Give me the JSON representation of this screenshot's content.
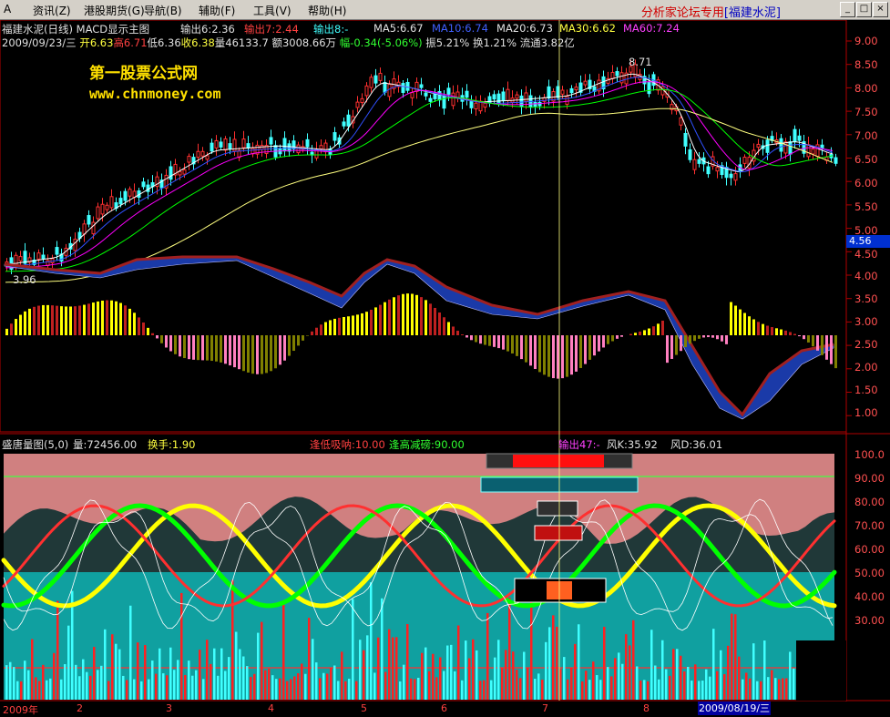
{
  "menu": {
    "items": [
      "资讯",
      "港股期货",
      "导航",
      "辅助",
      "工具",
      "帮助"
    ],
    "item_keys": [
      "(Z)",
      "(G)",
      "(B)",
      "(F)",
      "(V)",
      "(H)"
    ],
    "title_prefix": "分析家论坛专用",
    "title_stock": "[福建水泥]"
  },
  "header": {
    "stock_period": "福建水泥(日线)",
    "indicator_name": "MACD显示主图",
    "out1": "输出6:2.36",
    "out2": "输出7:2.44",
    "out3": "输出8:-",
    "ma5": "MA5:6.67",
    "ma10": "MA10:6.74",
    "ma20": "MA20:6.73",
    "ma30": "MA30:6.62",
    "ma60": "MA60:7.24",
    "date": "2009/09/23/三",
    "open": "开6.63",
    "high": "高6.71",
    "low": "低6.36",
    "close": "收6.38",
    "volume": "量46133.7",
    "amount": "额3008.66万",
    "change": "幅-0.34(-5.06%)",
    "amplitude": "振5.21%",
    "turnover": "换1.21%",
    "float_cap": "流通3.82亿"
  },
  "watermark": {
    "line1": "第一股票公式网",
    "line2": "www.chnmoney.com"
  },
  "annotations": {
    "high_mark": "8.71",
    "low_mark": "3.96"
  },
  "price_axis": [
    "9.00",
    "8.50",
    "8.00",
    "7.50",
    "7.00",
    "6.50",
    "6.00",
    "5.50",
    "5.00",
    "4.50",
    "4.00",
    "3.50",
    "3.00",
    "2.50",
    "2.00",
    "1.50",
    "1.00"
  ],
  "current_price_tag": "4.56",
  "lower_panel": {
    "name": "盛唐量图(5,0)",
    "volume": "量:72456.00",
    "turnover": "换手:1.90",
    "low_absorb": "逢低吸呐:10.00",
    "high_reduce": "逢高减磅:90.00",
    "out47": "输出47:-",
    "wind_k": "风K:35.92",
    "wind_d": "风D:36.01"
  },
  "lower_axis": [
    "100.0",
    "90.00",
    "80.00",
    "70.00",
    "60.00",
    "50.00",
    "40.00",
    "30.00"
  ],
  "date_axis": [
    "2009年",
    "2",
    "3",
    "4",
    "5",
    "6",
    "7",
    "8"
  ],
  "cursor_date": "2009/08/19/三",
  "colors": {
    "up": "#ff3030",
    "down": "#40ffff",
    "ma5": "#ffffff",
    "ma10": "#ffff00",
    "ma20": "#ff00ff",
    "ma30": "#00ff00",
    "ma60": "#ffff80",
    "axis": "#b00000"
  }
}
